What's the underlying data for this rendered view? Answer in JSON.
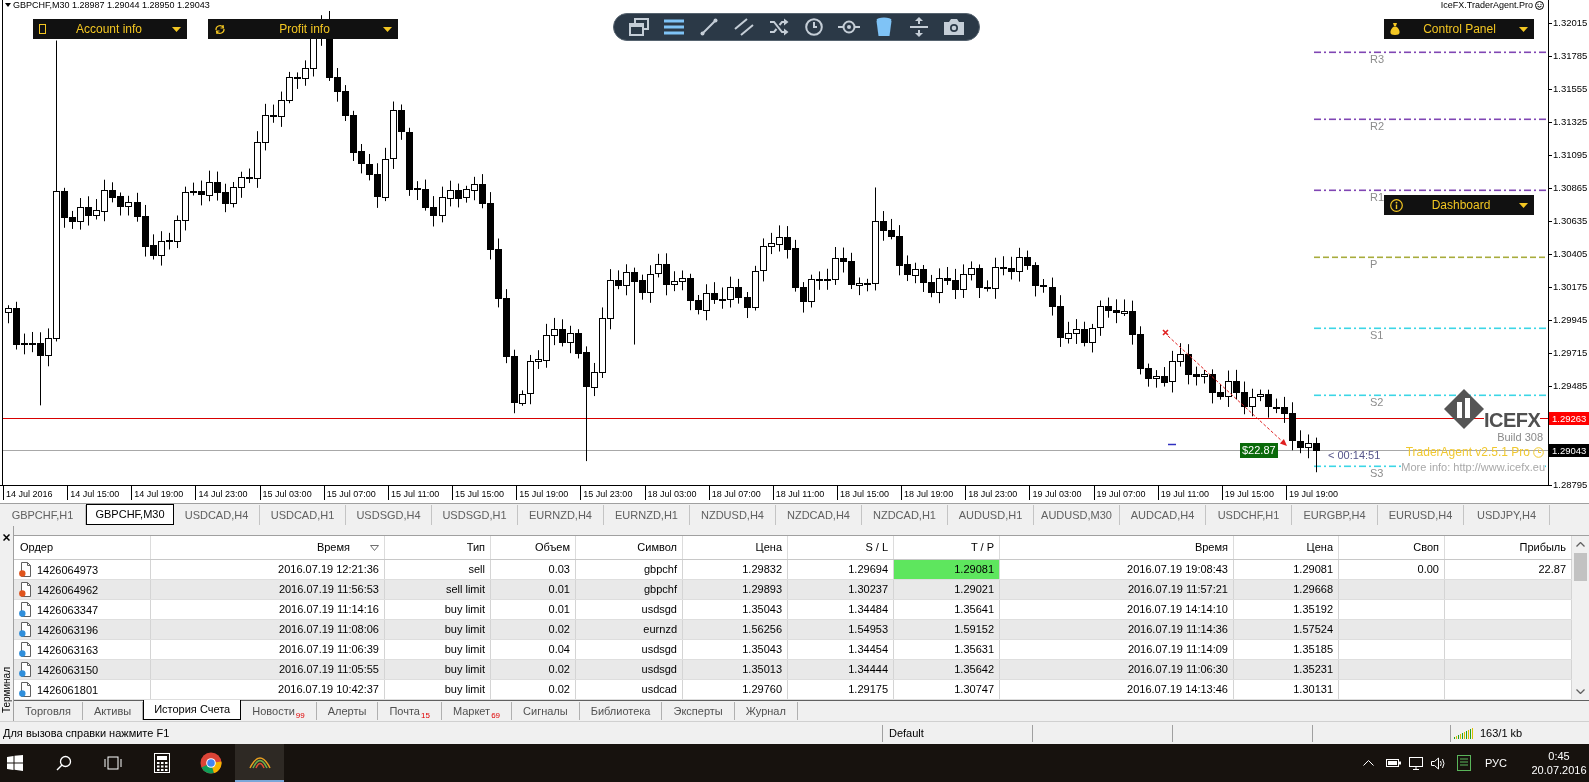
{
  "chart": {
    "header": "GBPCHF,M30 1.28987 1.29044 1.28950 1.29043",
    "indicator": "IceFX.TraderAgent.Pro",
    "panels": [
      {
        "kind": "account",
        "label": "Account info"
      },
      {
        "kind": "profit",
        "label": "Profit info"
      },
      {
        "kind": "control",
        "label": "Control Panel"
      },
      {
        "kind": "dashboard",
        "label": "Dashboard"
      }
    ],
    "toolbar": [
      {
        "kind": "windows",
        "active": false
      },
      {
        "kind": "menu",
        "active": true
      },
      {
        "kind": "line",
        "active": false
      },
      {
        "kind": "channel",
        "active": false
      },
      {
        "kind": "shuffle",
        "active": false
      },
      {
        "kind": "clock",
        "active": false
      },
      {
        "kind": "commit",
        "active": false
      },
      {
        "kind": "bucket",
        "active": true
      },
      {
        "kind": "split",
        "active": false
      },
      {
        "kind": "camera",
        "active": false
      }
    ],
    "price_ticks": [
      "1.32015",
      "1.31785",
      "1.31555",
      "1.31325",
      "1.31095",
      "1.30865",
      "1.30635",
      "1.30405",
      "1.30175",
      "1.29945",
      "1.29715",
      "1.29485",
      "1.28795"
    ],
    "price_lines": [
      {
        "kind": "alert",
        "label": "1.29263"
      },
      {
        "kind": "bid",
        "label": "1.29043"
      }
    ],
    "time_labels": [
      "14 Jul 2016",
      "14 Jul 15:00",
      "14 Jul 19:00",
      "14 Jul 23:00",
      "15 Jul 03:00",
      "15 Jul 07:00",
      "15 Jul 11:00",
      "15 Jul 15:00",
      "15 Jul 19:00",
      "15 Jul 23:00",
      "18 Jul 03:00",
      "18 Jul 07:00",
      "18 Jul 11:00",
      "18 Jul 15:00",
      "18 Jul 19:00",
      "18 Jul 23:00",
      "19 Jul 03:00",
      "19 Jul 07:00",
      "19 Jul 11:00",
      "19 Jul 15:00",
      "19 Jul 19:00"
    ],
    "pivots": [
      {
        "label": "R3",
        "color": "#8046b4"
      },
      {
        "label": "R2",
        "color": "#8046b4"
      },
      {
        "label": "R1",
        "color": "#8046b4"
      },
      {
        "label": "P",
        "color": "#a8ac3c"
      },
      {
        "label": "S1",
        "color": "#3cd6e6"
      },
      {
        "label": "S2",
        "color": "#3cd6e6"
      },
      {
        "label": "S3",
        "color": "#3cd6e6"
      }
    ],
    "trade_profit": "$22.87",
    "countdown": "< 00:14:51",
    "logo": {
      "name": "ICEFX",
      "build": "Build 308"
    },
    "version": "TraderAgent v2.5.1 Pro",
    "info": "More info: http://www.icefx.eu"
  },
  "symbol_tabs": [
    {
      "label": "GBPCHF,H1",
      "selected": false
    },
    {
      "label": "GBPCHF,M30",
      "selected": true
    },
    {
      "label": "USDCAD,H4",
      "selected": false
    },
    {
      "label": "USDCAD,H1",
      "selected": false
    },
    {
      "label": "USDSGD,H4",
      "selected": false
    },
    {
      "label": "USDSGD,H1",
      "selected": false
    },
    {
      "label": "EURNZD,H4",
      "selected": false
    },
    {
      "label": "EURNZD,H1",
      "selected": false
    },
    {
      "label": "NZDUSD,H4",
      "selected": false
    },
    {
      "label": "NZDCAD,H4",
      "selected": false
    },
    {
      "label": "NZDCAD,H1",
      "selected": false
    },
    {
      "label": "AUDUSD,H1",
      "selected": false
    },
    {
      "label": "AUDUSD,M30",
      "selected": false
    },
    {
      "label": "AUDCAD,H4",
      "selected": false
    },
    {
      "label": "USDCHF,H1",
      "selected": false
    },
    {
      "label": "EURGBP,H4",
      "selected": false
    },
    {
      "label": "EURUSD,H4",
      "selected": false
    },
    {
      "label": "USDJPY,H4",
      "selected": false
    }
  ],
  "terminal": {
    "title": "Терминал",
    "columns": [
      {
        "label": "Ордер",
        "sorted": false
      },
      {
        "label": "Время",
        "sorted": true
      },
      {
        "label": "Тип",
        "sorted": false
      },
      {
        "label": "Объем",
        "sorted": false
      },
      {
        "label": "Символ",
        "sorted": false
      },
      {
        "label": "Цена",
        "sorted": false
      },
      {
        "label": "S / L",
        "sorted": false
      },
      {
        "label": "T / P",
        "sorted": false
      },
      {
        "label": "Время",
        "sorted": false
      },
      {
        "label": "Цена",
        "sorted": false
      },
      {
        "label": "Своп",
        "sorted": false
      },
      {
        "label": "Прибыль",
        "sorted": false
      }
    ],
    "rows": [
      {
        "kind": "sell",
        "tp_hit": true,
        "cells": [
          "1426064973",
          "2016.07.19 12:21:36",
          "sell",
          "0.03",
          "gbpchf",
          "1.29832",
          "1.29694",
          "1.29081",
          "2016.07.19 19:08:43",
          "1.29081",
          "0.00",
          "22.87"
        ]
      },
      {
        "kind": "sell",
        "tp_hit": false,
        "cells": [
          "1426064962",
          "2016.07.19 11:56:53",
          "sell limit",
          "0.01",
          "gbpchf",
          "1.29893",
          "1.30237",
          "1.29021",
          "2016.07.19 11:57:21",
          "1.29668"
        ]
      },
      {
        "kind": "buy",
        "tp_hit": false,
        "cells": [
          "1426063347",
          "2016.07.19 11:14:16",
          "buy limit",
          "0.01",
          "usdsgd",
          "1.35043",
          "1.34484",
          "1.35641",
          "2016.07.19 14:14:10",
          "1.35192"
        ]
      },
      {
        "kind": "buy",
        "tp_hit": false,
        "cells": [
          "1426063196",
          "2016.07.19 11:08:06",
          "buy limit",
          "0.02",
          "eurnzd",
          "1.56256",
          "1.54953",
          "1.59152",
          "2016.07.19 11:14:36",
          "1.57524"
        ]
      },
      {
        "kind": "buy",
        "tp_hit": false,
        "cells": [
          "1426063163",
          "2016.07.19 11:06:39",
          "buy limit",
          "0.04",
          "usdsgd",
          "1.35043",
          "1.34454",
          "1.35631",
          "2016.07.19 11:14:09",
          "1.35185"
        ]
      },
      {
        "kind": "buy",
        "tp_hit": false,
        "cells": [
          "1426063150",
          "2016.07.19 11:05:55",
          "buy limit",
          "0.02",
          "usdsgd",
          "1.35013",
          "1.34444",
          "1.35642",
          "2016.07.19 11:06:30",
          "1.35231"
        ]
      },
      {
        "kind": "buy",
        "tp_hit": false,
        "cells": [
          "1426061801",
          "2016.07.19 10:42:37",
          "buy limit",
          "0.02",
          "usdcad",
          "1.29760",
          "1.29175",
          "1.30747",
          "2016.07.19 14:13:46",
          "1.30131"
        ]
      }
    ],
    "tabs": [
      {
        "label": "Торговля",
        "selected": false
      },
      {
        "label": "Активы",
        "selected": false
      },
      {
        "label": "История Счета",
        "selected": true
      },
      {
        "label": "Новости",
        "count": "99",
        "selected": false
      },
      {
        "label": "Алерты",
        "selected": false
      },
      {
        "label": "Почта",
        "count": "15",
        "selected": false
      },
      {
        "label": "Маркет",
        "count": "69",
        "selected": false
      },
      {
        "label": "Сигналы",
        "selected": false
      },
      {
        "label": "Библиотека",
        "selected": false
      },
      {
        "label": "Эксперты",
        "selected": false
      },
      {
        "label": "Журнал",
        "selected": false
      }
    ]
  },
  "status_bar": {
    "hint": "Для вызова справки нажмите F1",
    "profile": "Default",
    "traffic": "163/1 kb"
  },
  "taskbar": {
    "language": "РУС",
    "time": "0:45",
    "date": "20.07.2016"
  }
}
